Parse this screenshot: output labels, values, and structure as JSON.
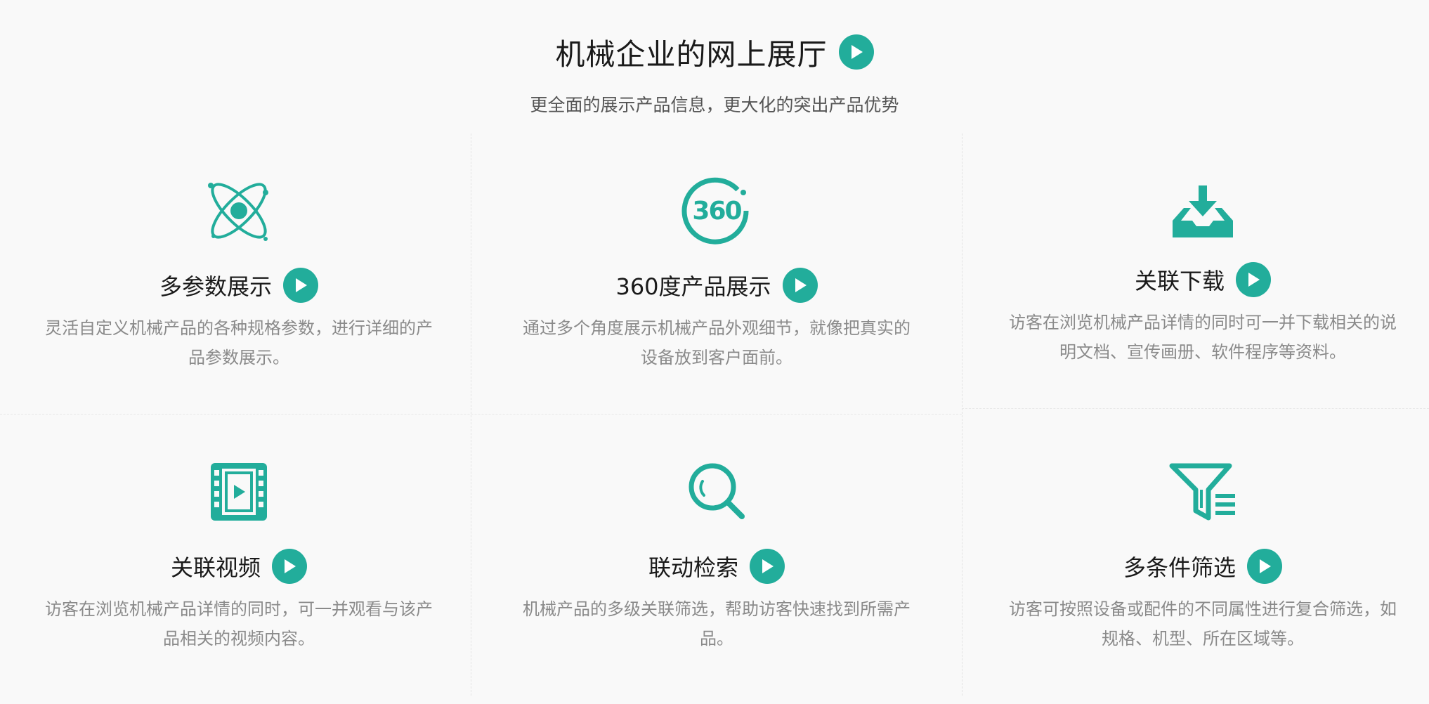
{
  "header": {
    "title": "机械企业的网上展厅",
    "subtitle": "更全面的展示产品信息，更大化的突出产品优势"
  },
  "features": [
    {
      "icon": "atom-icon",
      "title": "多参数展示",
      "desc": "灵活自定义机械产品的各种规格参数，进行详细的产品参数展示。"
    },
    {
      "icon": "360-view-icon",
      "title": "360度产品展示",
      "desc": "通过多个角度展示机械产品外观细节，就像把真实的设备放到客户面前。"
    },
    {
      "icon": "download-tray-icon",
      "title": "关联下载",
      "desc": "访客在浏览机械产品详情的同时可一并下载相关的说明文档、宣传画册、软件程序等资料。"
    },
    {
      "icon": "video-film-icon",
      "title": "关联视频",
      "desc": "访客在浏览机械产品详情的同时，可一并观看与该产品相关的视频内容。"
    },
    {
      "icon": "search-icon",
      "title": "联动检索",
      "desc": "机械产品的多级关联筛选，帮助访客快速找到所需产品。"
    },
    {
      "icon": "filter-list-icon",
      "title": "多条件筛选",
      "desc": "访客可按照设备或配件的不同属性进行复合筛选，如规格、机型、所在区域等。"
    }
  ],
  "colors": {
    "accent": "#22ad9b",
    "background": "#f9f9f9",
    "title": "#1a1a1a",
    "desc": "#8a8a8a"
  }
}
